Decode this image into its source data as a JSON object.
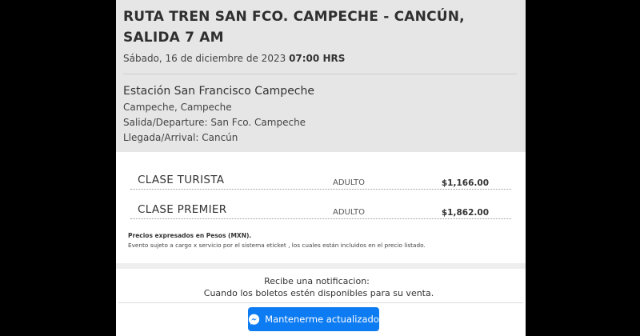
{
  "event": {
    "title": "RUTA TREN SAN FCO. CAMPECHE - CANCÚN, SALIDA 7 AM",
    "date": "Sábado, 16 de diciembre de 2023",
    "time": "07:00 HRS",
    "venue_name": "Estación San Francisco Campeche",
    "city": "Campeche, Campeche",
    "departure": "Salida/Departure: San Fco. Campeche",
    "arrival": "Llegada/Arrival: Cancún"
  },
  "prices": {
    "rows": [
      {
        "class": "CLASE TURISTA",
        "audience": "ADULTO",
        "price": "$1,166.00"
      },
      {
        "class": "CLASE PREMIER",
        "audience": "ADULTO",
        "price": "$1,862.00"
      }
    ],
    "note_title": "Precios expresados en Pesos (MXN).",
    "note_text": "Evento sujeto a cargo x servicio por el sistema eticket , los cuales están incluidos en el precio listado."
  },
  "notify": {
    "title": "Recibe una notificacion:",
    "subtitle": "Cuando los boletos estén disponibles para su venta.",
    "button_label": "Mantenerme actualizado",
    "button_icon": "messenger-icon",
    "button_color": "#0d7bf2"
  }
}
